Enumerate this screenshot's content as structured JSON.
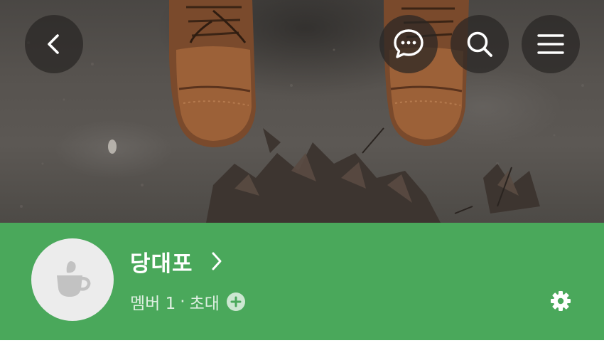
{
  "cover": {
    "description_icon": "cover-photo"
  },
  "topbar": {
    "back_icon": "chevron-left-icon",
    "chat_icon": "chat-bubble-icon",
    "search_icon": "search-icon",
    "menu_icon": "hamburger-menu-icon"
  },
  "profile": {
    "name": "당대포",
    "members_label": "멤버 1",
    "separator": "·",
    "invite_label": "초대",
    "avatar_icon": "coffee-cup-icon",
    "settings_icon": "gear-icon"
  },
  "colors": {
    "band": "#4aa85b",
    "text": "#ffffff",
    "avatar_bg": "#ececec",
    "button_bg": "#28262488"
  }
}
